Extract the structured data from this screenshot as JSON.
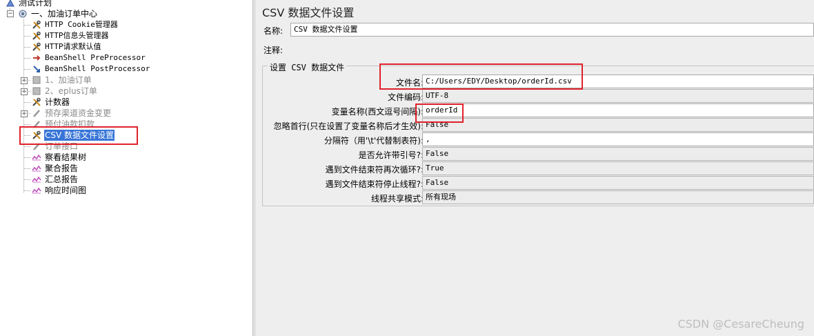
{
  "tree": {
    "root": "测试计划",
    "group": "一、加油订单中心",
    "items": [
      {
        "label": "HTTP Cookie管理器",
        "icon": "wrench-icon",
        "mono": true,
        "disabled": false
      },
      {
        "label": "HTTP信息头管理器",
        "icon": "wrench-icon",
        "mono": true,
        "disabled": false
      },
      {
        "label": "HTTP请求默认值",
        "icon": "wrench-icon",
        "mono": true,
        "disabled": false
      },
      {
        "label": "BeanShell PreProcessor",
        "icon": "preprocessor-icon",
        "mono": true,
        "disabled": false
      },
      {
        "label": "BeanShell PostProcessor",
        "icon": "postprocessor-icon",
        "mono": true,
        "disabled": false
      },
      {
        "label": "1、加油订单",
        "icon": "controller-icon",
        "mono": false,
        "disabled": true
      },
      {
        "label": "2、eplus订单",
        "icon": "controller-icon",
        "mono": false,
        "disabled": true
      },
      {
        "label": "计数器",
        "icon": "wrench-icon",
        "mono": false,
        "disabled": false
      },
      {
        "label": "预存渠道资金变更",
        "icon": "sampler-icon",
        "mono": false,
        "disabled": true
      },
      {
        "label": "预付油款扣款",
        "icon": "sampler-icon",
        "mono": false,
        "disabled": true
      },
      {
        "label": "CSV 数据文件设置",
        "icon": "wrench-icon",
        "mono": false,
        "disabled": false,
        "selected": true
      },
      {
        "label": "订单接口",
        "icon": "sampler-icon",
        "mono": false,
        "disabled": true
      },
      {
        "label": "察看结果树",
        "icon": "listener-icon",
        "mono": false,
        "disabled": false
      },
      {
        "label": "聚合报告",
        "icon": "listener-icon",
        "mono": false,
        "disabled": false
      },
      {
        "label": "汇总报告",
        "icon": "listener-icon",
        "mono": false,
        "disabled": false
      },
      {
        "label": "响应时间图",
        "icon": "listener-icon",
        "mono": false,
        "disabled": false
      }
    ]
  },
  "panel": {
    "title": "CSV 数据文件设置",
    "name_label": "名称:",
    "name_value": "CSV 数据文件设置",
    "comment_label": "注释:",
    "comment_value": "",
    "fieldset_legend": "设置 CSV 数据文件",
    "fields": [
      {
        "label": "文件名:",
        "value": "C:/Users/EDY/Desktop/orderId.csv",
        "grey": false
      },
      {
        "label": "文件编码:",
        "value": "UTF-8",
        "grey": true
      },
      {
        "label": "变量名称(西文逗号间隔):",
        "value": "orderId",
        "grey": false
      },
      {
        "label": "忽略首行(只在设置了变量名称后才生效):",
        "value": "False",
        "grey": true
      },
      {
        "label": "分隔符（用'\\t'代替制表符):",
        "value": ",",
        "grey": false
      },
      {
        "label": "是否允许带引号?:",
        "value": "False",
        "grey": true
      },
      {
        "label": "遇到文件结束符再次循环?:",
        "value": "True",
        "grey": true
      },
      {
        "label": "遇到文件结束符停止线程?:",
        "value": "False",
        "grey": true
      },
      {
        "label": "线程共享模式:",
        "value": "所有现场",
        "grey": true
      }
    ]
  },
  "watermark": "CSDN @CesareCheung",
  "colors": {
    "selection": "#3875d7",
    "highlight": "#e0202a"
  }
}
